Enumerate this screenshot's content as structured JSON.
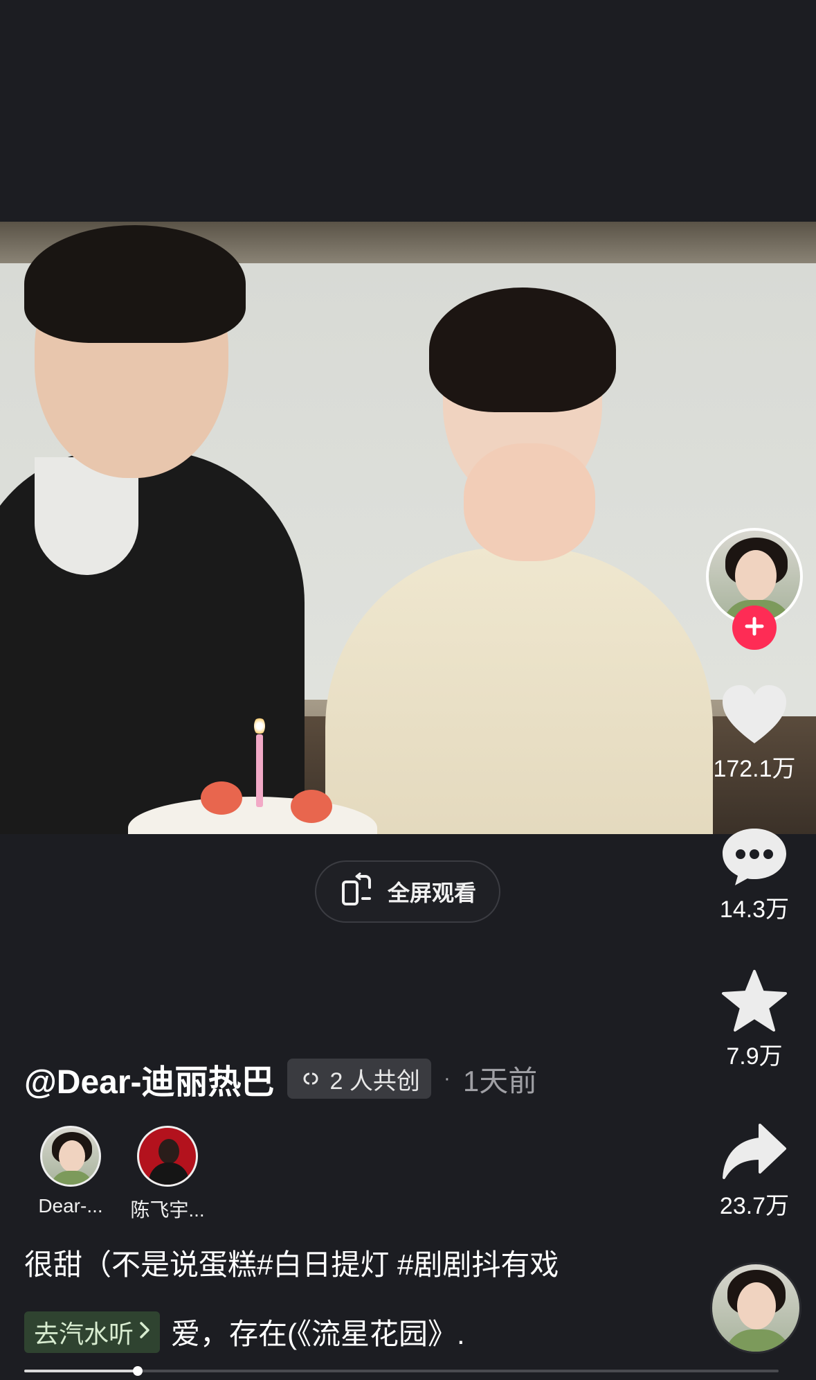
{
  "video": {
    "progress": 0.15
  },
  "fullscreen_button": {
    "label": "全屏观看"
  },
  "rail": {
    "like_count": "172.1万",
    "comment_count": "14.3万",
    "favorite_count": "7.9万",
    "share_count": "23.7万"
  },
  "author": {
    "handle": "@Dear-迪丽热巴",
    "cocreate_label": "2 人共创",
    "separator": "·",
    "posted": "1天前"
  },
  "creators": [
    {
      "name": "Dear-..."
    },
    {
      "name": "陈飞宇..."
    }
  ],
  "caption": {
    "text": "很甜（不是说蛋糕#白日提灯 #剧剧抖有戏"
  },
  "music": {
    "tag_label": "去汽水听",
    "song_text": "爱，存在(《流星花园》."
  },
  "colors": {
    "background": "#1c1d22",
    "follow_accent": "#fe2c55",
    "music_tag_bg": "#2f4330"
  }
}
